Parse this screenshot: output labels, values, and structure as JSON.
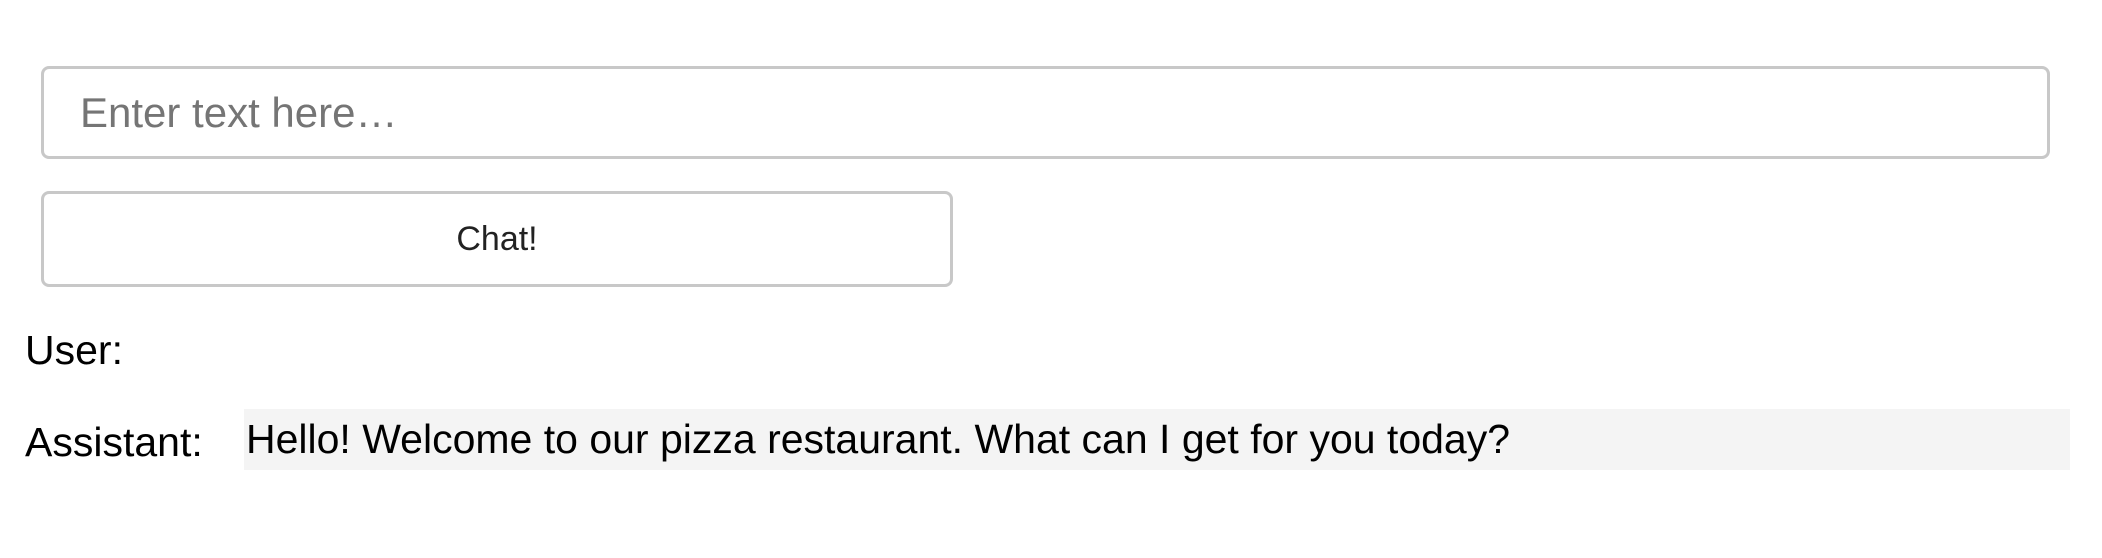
{
  "input": {
    "placeholder": "Enter text here…",
    "value": ""
  },
  "actions": {
    "chat_label": "Chat!"
  },
  "conversation": {
    "user_label": "User:",
    "user_message": "",
    "assistant_label": "Assistant:",
    "assistant_message": "Hello! Welcome to our pizza restaurant. What can I get for you today?"
  },
  "colors": {
    "border": "#c8c8c8",
    "assistant_bg": "#f4f4f4",
    "placeholder": "#757575"
  }
}
